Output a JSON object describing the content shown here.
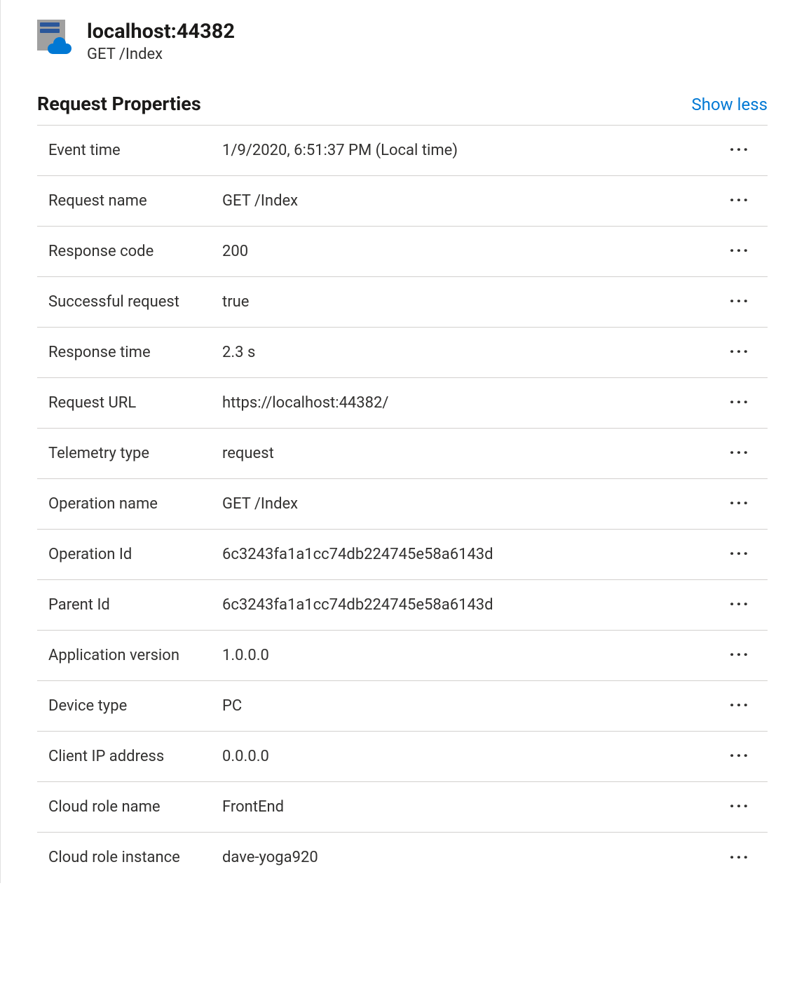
{
  "header": {
    "title": "localhost:44382",
    "subtitle": "GET /Index"
  },
  "section": {
    "title": "Request Properties",
    "toggle_label": "Show less"
  },
  "properties": [
    {
      "label": "Event time",
      "value": "1/9/2020, 6:51:37 PM (Local time)"
    },
    {
      "label": "Request name",
      "value": "GET /Index"
    },
    {
      "label": "Response code",
      "value": "200"
    },
    {
      "label": "Successful request",
      "value": "true"
    },
    {
      "label": "Response time",
      "value": "2.3 s"
    },
    {
      "label": "Request URL",
      "value": "https://localhost:44382/"
    },
    {
      "label": "Telemetry type",
      "value": "request"
    },
    {
      "label": "Operation name",
      "value": "GET /Index"
    },
    {
      "label": "Operation Id",
      "value": "6c3243fa1a1cc74db224745e58a6143d"
    },
    {
      "label": "Parent Id",
      "value": "6c3243fa1a1cc74db224745e58a6143d"
    },
    {
      "label": "Application version",
      "value": "1.0.0.0"
    },
    {
      "label": "Device type",
      "value": "PC"
    },
    {
      "label": "Client IP address",
      "value": "0.0.0.0"
    },
    {
      "label": "Cloud role name",
      "value": "FrontEnd"
    },
    {
      "label": "Cloud role instance",
      "value": "dave-yoga920"
    }
  ]
}
